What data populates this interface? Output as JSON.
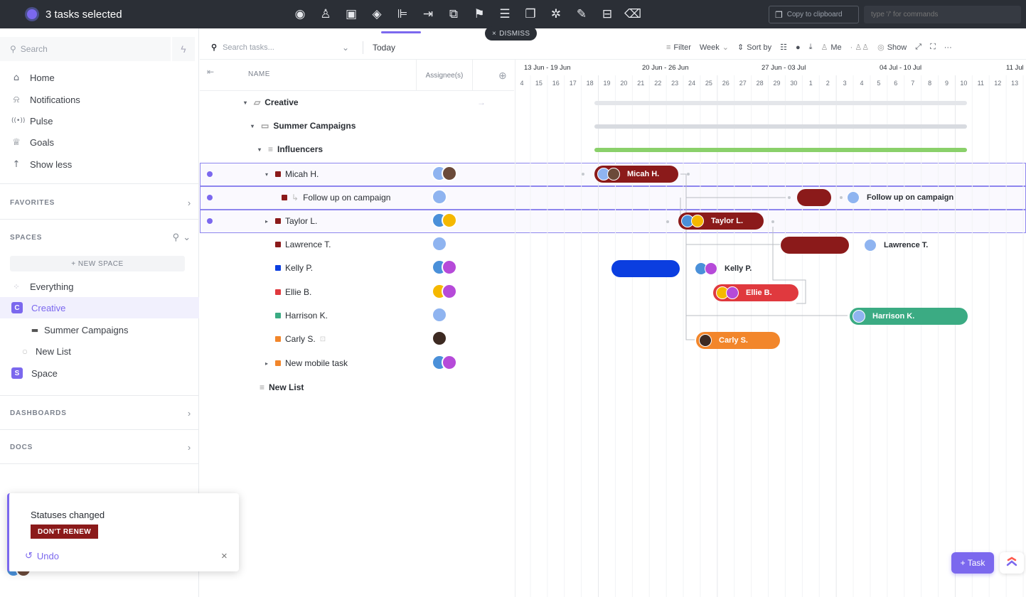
{
  "bulk_bar": {
    "selection_text": "3 tasks selected",
    "tool_icons": [
      "eye-icon",
      "add-assignee-icon",
      "tag-icon",
      "status-icon",
      "subtask-icon",
      "move-icon",
      "duplicate-icon",
      "priority-flag-icon",
      "sort-icon",
      "copy-icon",
      "dependency-icon",
      "edit-icon",
      "archive-icon",
      "trash-icon"
    ],
    "copy_label": "Copy to clipboard",
    "command_placeholder": "type '/' for commands",
    "dismiss_label": "DISMISS"
  },
  "sidebar": {
    "search_placeholder": "Search",
    "nav": [
      {
        "label": "Home",
        "icon": "home-icon",
        "glyph": "⌂"
      },
      {
        "label": "Notifications",
        "icon": "bell-icon",
        "glyph": "♫"
      },
      {
        "label": "Pulse",
        "icon": "pulse-icon",
        "glyph": "◉"
      },
      {
        "label": "Goals",
        "icon": "trophy-icon",
        "glyph": "♕"
      },
      {
        "label": "Show less",
        "icon": "arrow-up-icon",
        "glyph": "↑"
      }
    ],
    "favorites_label": "FAVORITES",
    "spaces_label": "SPACES",
    "new_space_label": "+ NEW SPACE",
    "spaces": [
      {
        "label": "Everything",
        "badge": "",
        "color": "#c8ccd2"
      },
      {
        "label": "Creative",
        "badge": "C",
        "color": "#7b68ee"
      },
      {
        "label": "Summer Campaigns",
        "badge": "",
        "color": ""
      },
      {
        "label": "New List",
        "badge": "",
        "color": ""
      },
      {
        "label": "Space",
        "badge": "S",
        "color": "#7b68ee"
      }
    ],
    "dashboards_label": "DASHBOARDS",
    "docs_label": "DOCS"
  },
  "toast": {
    "title": "Statuses changed",
    "status": "DON'T RENEW",
    "undo_label": "Undo",
    "close": "×"
  },
  "toolbar": {
    "search_placeholder": "Search tasks...",
    "today": "Today",
    "filter": "Filter",
    "week": "Week",
    "sort": "Sort by",
    "me": "Me",
    "show": "Show"
  },
  "table": {
    "col_name": "NAME",
    "col_assignee": "Assignee(s)",
    "rows": [
      {
        "label": "Creative",
        "kind": "space",
        "color": ""
      },
      {
        "label": "Summer Campaigns",
        "kind": "folder",
        "color": ""
      },
      {
        "label": "Influencers",
        "kind": "list",
        "color": ""
      },
      {
        "label": "Micah H.",
        "kind": "task",
        "color": "#8b1a1a",
        "selected": true
      },
      {
        "label": "Follow up on campaign",
        "kind": "subtask",
        "color": "#8b1a1a",
        "selected": true
      },
      {
        "label": "Taylor L.",
        "kind": "task",
        "color": "#8b1a1a",
        "selected": true
      },
      {
        "label": "Lawrence T.",
        "kind": "task",
        "color": "#8b1a1a"
      },
      {
        "label": "Kelly P.",
        "kind": "task",
        "color": "#0b3ee0"
      },
      {
        "label": "Ellie B.",
        "kind": "task",
        "color": "#e0393e"
      },
      {
        "label": "Harrison K.",
        "kind": "task",
        "color": "#3bab83"
      },
      {
        "label": "Carly S.",
        "kind": "task",
        "color": "#f2862b"
      },
      {
        "label": "New mobile task",
        "kind": "task",
        "color": "#f2862b"
      },
      {
        "label": "New List",
        "kind": "list",
        "color": ""
      }
    ]
  },
  "gantt": {
    "weeks": [
      "13 Jun - 19 Jun",
      "20 Jun - 26 Jun",
      "27 Jun - 03 Jul",
      "04 Jul - 10 Jul",
      "11 Jul"
    ],
    "days": [
      "4",
      "15",
      "16",
      "17",
      "18",
      "19",
      "20",
      "21",
      "22",
      "23",
      "24",
      "25",
      "26",
      "27",
      "28",
      "29",
      "30",
      "1",
      "2",
      "3",
      "4",
      "5",
      "6",
      "7",
      "8",
      "9",
      "10",
      "11",
      "12",
      "13"
    ],
    "bars": [
      {
        "label": "Micah H.",
        "color": "#8b1a1a"
      },
      {
        "label": "Follow up on campaign",
        "color": "#8b1a1a"
      },
      {
        "label": "Taylor L.",
        "color": "#8b1a1a"
      },
      {
        "label": "Lawrence T.",
        "color": "#8b1a1a"
      },
      {
        "label": "Kelly P.",
        "color": "#0b3ee0"
      },
      {
        "label": "Ellie B.",
        "color": "#e0393e"
      },
      {
        "label": "Harrison K.",
        "color": "#3bab83"
      },
      {
        "label": "Carly S.",
        "color": "#f2862b"
      }
    ]
  },
  "task_button": "+ Task",
  "colors": {
    "accent": "#7b68ee",
    "dark_bar": "#2b2f36"
  }
}
